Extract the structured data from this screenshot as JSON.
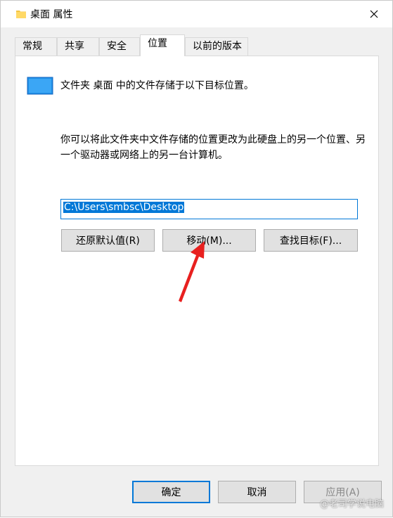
{
  "window": {
    "title": "桌面 属性"
  },
  "tabs": [
    {
      "label": "常规"
    },
    {
      "label": "共享"
    },
    {
      "label": "安全"
    },
    {
      "label": "位置"
    },
    {
      "label": "以前的版本"
    }
  ],
  "panel": {
    "intro": "文件夹 桌面 中的文件存储于以下目标位置。",
    "desc": "你可以将此文件夹中文件存储的位置更改为此硬盘上的另一个位置、另一个驱动器或网络上的另一台计算机。",
    "path_value": "C:\\Users\\smbsc\\Desktop",
    "buttons": {
      "restore": "还原默认值(R)",
      "move": "移动(M)...",
      "find": "查找目标(F)..."
    }
  },
  "footer": {
    "ok": "确定",
    "cancel": "取消",
    "apply": "应用(A)"
  },
  "watermark": "@老司学说电脑",
  "colors": {
    "accent": "#0078d7",
    "arrow": "#e8201f"
  }
}
